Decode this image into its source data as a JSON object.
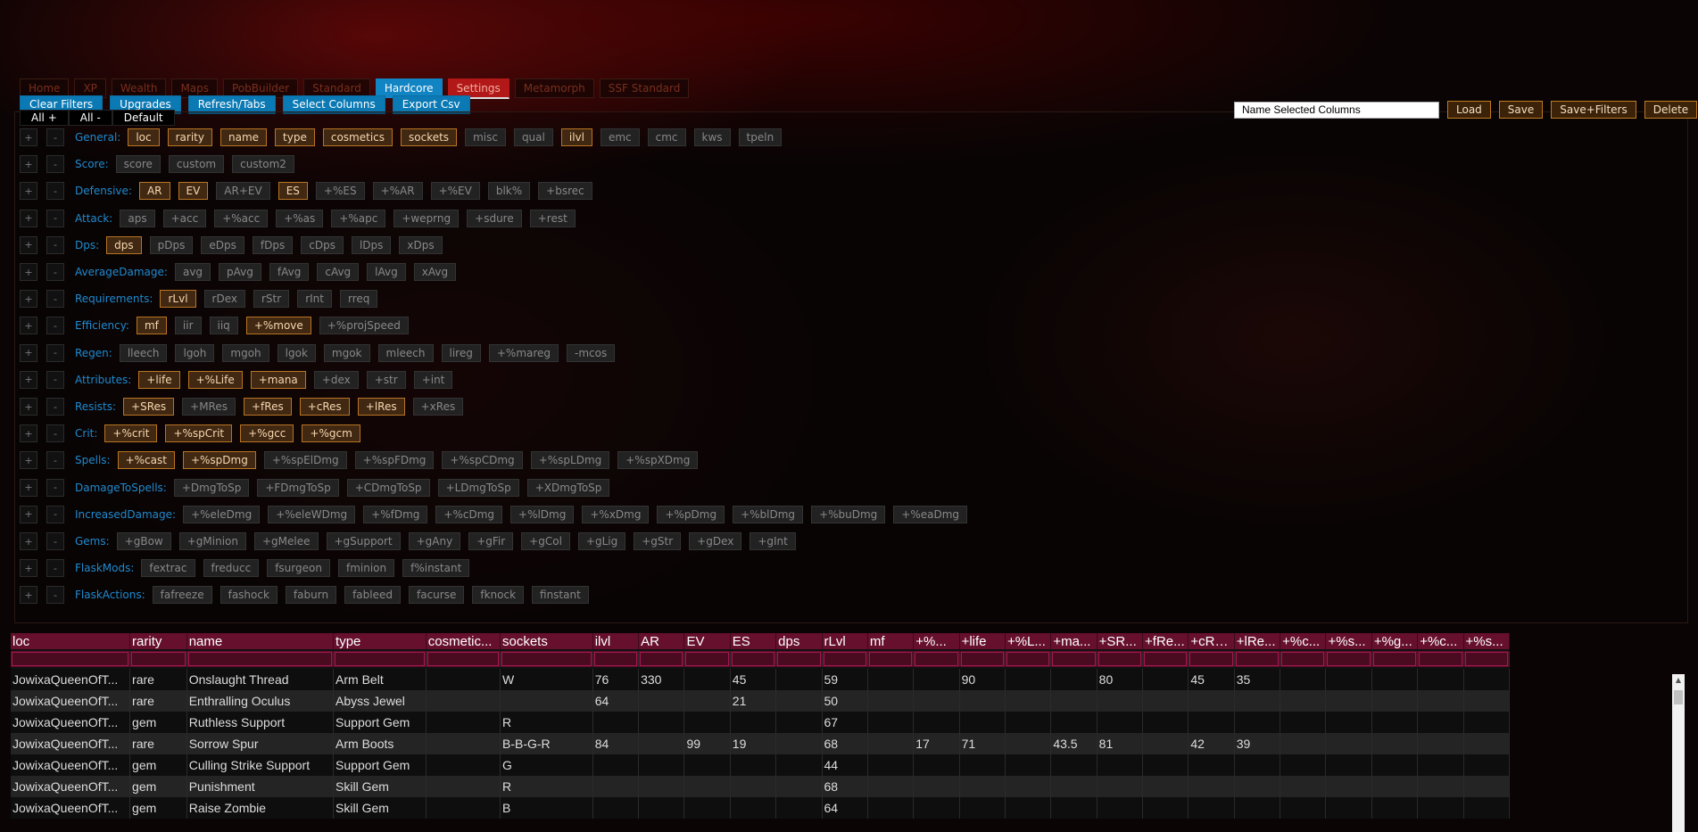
{
  "nav": {
    "tabs": [
      {
        "label": "Home",
        "state": "normal"
      },
      {
        "label": "XP",
        "state": "normal"
      },
      {
        "label": "Wealth",
        "state": "normal"
      },
      {
        "label": "Maps",
        "state": "normal"
      },
      {
        "label": "PobBuilder",
        "state": "normal"
      },
      {
        "label": "Standard",
        "state": "normal"
      },
      {
        "label": "Hardcore",
        "state": "active"
      },
      {
        "label": "Settings",
        "state": "settings"
      },
      {
        "label": "Metamorph",
        "state": "normal"
      },
      {
        "label": "SSF Standard",
        "state": "normal"
      }
    ]
  },
  "actions": {
    "buttons": [
      "Clear Filters",
      "Upgrades",
      "Refresh/Tabs",
      "Select Columns",
      "Export Csv"
    ],
    "all_plus": "All +",
    "all_minus": "All -",
    "default": "Default"
  },
  "presets": {
    "name_placeholder": "Name Selected Columns",
    "load": "Load",
    "save": "Save",
    "save_filters": "Save+Filters",
    "delete": "Delete"
  },
  "filter_groups": [
    {
      "label": "General:",
      "chips": [
        {
          "t": "loc",
          "on": true
        },
        {
          "t": "rarity",
          "on": true
        },
        {
          "t": "name",
          "on": true
        },
        {
          "t": "type",
          "on": true
        },
        {
          "t": "cosmetics",
          "on": true
        },
        {
          "t": "sockets",
          "on": true
        },
        {
          "t": "misc",
          "on": false
        },
        {
          "t": "qual",
          "on": false
        },
        {
          "t": "ilvl",
          "on": true
        },
        {
          "t": "emc",
          "on": false
        },
        {
          "t": "cmc",
          "on": false
        },
        {
          "t": "kws",
          "on": false
        },
        {
          "t": "tpeln",
          "on": false
        }
      ]
    },
    {
      "label": "Score:",
      "chips": [
        {
          "t": "score",
          "on": false
        },
        {
          "t": "custom",
          "on": false
        },
        {
          "t": "custom2",
          "on": false
        }
      ]
    },
    {
      "label": "Defensive:",
      "chips": [
        {
          "t": "AR",
          "on": true
        },
        {
          "t": "EV",
          "on": true
        },
        {
          "t": "AR+EV",
          "on": false
        },
        {
          "t": "ES",
          "on": true
        },
        {
          "t": "+%ES",
          "on": false
        },
        {
          "t": "+%AR",
          "on": false
        },
        {
          "t": "+%EV",
          "on": false
        },
        {
          "t": "blk%",
          "on": false
        },
        {
          "t": "+bsrec",
          "on": false
        }
      ]
    },
    {
      "label": "Attack:",
      "chips": [
        {
          "t": "aps",
          "on": false
        },
        {
          "t": "+acc",
          "on": false
        },
        {
          "t": "+%acc",
          "on": false
        },
        {
          "t": "+%as",
          "on": false
        },
        {
          "t": "+%apc",
          "on": false
        },
        {
          "t": "+weprng",
          "on": false
        },
        {
          "t": "+sdure",
          "on": false
        },
        {
          "t": "+rest",
          "on": false
        }
      ]
    },
    {
      "label": "Dps:",
      "chips": [
        {
          "t": "dps",
          "on": true
        },
        {
          "t": "pDps",
          "on": false
        },
        {
          "t": "eDps",
          "on": false
        },
        {
          "t": "fDps",
          "on": false
        },
        {
          "t": "cDps",
          "on": false
        },
        {
          "t": "lDps",
          "on": false
        },
        {
          "t": "xDps",
          "on": false
        }
      ]
    },
    {
      "label": "AverageDamage:",
      "chips": [
        {
          "t": "avg",
          "on": false
        },
        {
          "t": "pAvg",
          "on": false
        },
        {
          "t": "fAvg",
          "on": false
        },
        {
          "t": "cAvg",
          "on": false
        },
        {
          "t": "lAvg",
          "on": false
        },
        {
          "t": "xAvg",
          "on": false
        }
      ]
    },
    {
      "label": "Requirements:",
      "chips": [
        {
          "t": "rLvl",
          "on": true
        },
        {
          "t": "rDex",
          "on": false
        },
        {
          "t": "rStr",
          "on": false
        },
        {
          "t": "rInt",
          "on": false
        },
        {
          "t": "rreq",
          "on": false
        }
      ]
    },
    {
      "label": "Efficiency:",
      "chips": [
        {
          "t": "mf",
          "on": true
        },
        {
          "t": "iir",
          "on": false
        },
        {
          "t": "iiq",
          "on": false
        },
        {
          "t": "+%move",
          "on": true
        },
        {
          "t": "+%projSpeed",
          "on": false
        }
      ]
    },
    {
      "label": "Regen:",
      "chips": [
        {
          "t": "lleech",
          "on": false
        },
        {
          "t": "lgoh",
          "on": false
        },
        {
          "t": "mgoh",
          "on": false
        },
        {
          "t": "lgok",
          "on": false
        },
        {
          "t": "mgok",
          "on": false
        },
        {
          "t": "mleech",
          "on": false
        },
        {
          "t": "lireg",
          "on": false
        },
        {
          "t": "+%mareg",
          "on": false
        },
        {
          "t": "-mcos",
          "on": false
        }
      ]
    },
    {
      "label": "Attributes:",
      "chips": [
        {
          "t": "+life",
          "on": true
        },
        {
          "t": "+%Life",
          "on": true
        },
        {
          "t": "+mana",
          "on": true
        },
        {
          "t": "+dex",
          "on": false
        },
        {
          "t": "+str",
          "on": false
        },
        {
          "t": "+int",
          "on": false
        }
      ]
    },
    {
      "label": "Resists:",
      "chips": [
        {
          "t": "+SRes",
          "on": true
        },
        {
          "t": "+MRes",
          "on": false
        },
        {
          "t": "+fRes",
          "on": true
        },
        {
          "t": "+cRes",
          "on": true
        },
        {
          "t": "+lRes",
          "on": true
        },
        {
          "t": "+xRes",
          "on": false
        }
      ]
    },
    {
      "label": "Crit:",
      "chips": [
        {
          "t": "+%crit",
          "on": true
        },
        {
          "t": "+%spCrit",
          "on": true
        },
        {
          "t": "+%gcc",
          "on": true
        },
        {
          "t": "+%gcm",
          "on": true
        }
      ]
    },
    {
      "label": "Spells:",
      "chips": [
        {
          "t": "+%cast",
          "on": true
        },
        {
          "t": "+%spDmg",
          "on": true
        },
        {
          "t": "+%spElDmg",
          "on": false
        },
        {
          "t": "+%spFDmg",
          "on": false
        },
        {
          "t": "+%spCDmg",
          "on": false
        },
        {
          "t": "+%spLDmg",
          "on": false
        },
        {
          "t": "+%spXDmg",
          "on": false
        }
      ]
    },
    {
      "label": "DamageToSpells:",
      "chips": [
        {
          "t": "+DmgToSp",
          "on": false
        },
        {
          "t": "+FDmgToSp",
          "on": false
        },
        {
          "t": "+CDmgToSp",
          "on": false
        },
        {
          "t": "+LDmgToSp",
          "on": false
        },
        {
          "t": "+XDmgToSp",
          "on": false
        }
      ]
    },
    {
      "label": "IncreasedDamage:",
      "chips": [
        {
          "t": "+%eleDmg",
          "on": false
        },
        {
          "t": "+%eleWDmg",
          "on": false
        },
        {
          "t": "+%fDmg",
          "on": false
        },
        {
          "t": "+%cDmg",
          "on": false
        },
        {
          "t": "+%lDmg",
          "on": false
        },
        {
          "t": "+%xDmg",
          "on": false
        },
        {
          "t": "+%pDmg",
          "on": false
        },
        {
          "t": "+%blDmg",
          "on": false
        },
        {
          "t": "+%buDmg",
          "on": false
        },
        {
          "t": "+%eaDmg",
          "on": false
        }
      ]
    },
    {
      "label": "Gems:",
      "chips": [
        {
          "t": "+gBow",
          "on": false
        },
        {
          "t": "+gMinion",
          "on": false
        },
        {
          "t": "+gMelee",
          "on": false
        },
        {
          "t": "+gSupport",
          "on": false
        },
        {
          "t": "+gAny",
          "on": false
        },
        {
          "t": "+gFir",
          "on": false
        },
        {
          "t": "+gCol",
          "on": false
        },
        {
          "t": "+gLig",
          "on": false
        },
        {
          "t": "+gStr",
          "on": false
        },
        {
          "t": "+gDex",
          "on": false
        },
        {
          "t": "+gInt",
          "on": false
        }
      ]
    },
    {
      "label": "FlaskMods:",
      "chips": [
        {
          "t": "fextrac",
          "on": false
        },
        {
          "t": "freducc",
          "on": false
        },
        {
          "t": "fsurgeon",
          "on": false
        },
        {
          "t": "fminion",
          "on": false
        },
        {
          "t": "f%instant",
          "on": false
        }
      ]
    },
    {
      "label": "FlaskActions:",
      "chips": [
        {
          "t": "fafreeze",
          "on": false
        },
        {
          "t": "fashock",
          "on": false
        },
        {
          "t": "faburn",
          "on": false
        },
        {
          "t": "fableed",
          "on": false
        },
        {
          "t": "facurse",
          "on": false
        },
        {
          "t": "fknock",
          "on": false
        },
        {
          "t": "finstant",
          "on": false
        }
      ]
    }
  ],
  "pm_labels": {
    "plus": "+",
    "minus": "-"
  },
  "table": {
    "columns": [
      "loc",
      "rarity",
      "name",
      "type",
      "cosmetic...",
      "sockets",
      "ilvl",
      "AR",
      "EV",
      "ES",
      "dps",
      "rLvl",
      "mf",
      "+%...",
      "+life",
      "+%L...",
      "+ma...",
      "+SR...",
      "+fRe...",
      "+cRe...",
      "+lRe...",
      "+%c...",
      "+%s...",
      "+%g...",
      "+%c...",
      "+%s..."
    ],
    "rows": [
      [
        "JowixaQueenOfT...",
        "rare",
        "Onslaught Thread",
        "Arm Belt",
        "",
        "W",
        "76",
        "330",
        "",
        "45",
        "",
        "59",
        "",
        "",
        "90",
        "",
        "",
        "80",
        "",
        "45",
        "35",
        "",
        "",
        "",
        "",
        ""
      ],
      [
        "JowixaQueenOfT...",
        "rare",
        "Enthralling Oculus",
        "Abyss Jewel",
        "",
        "",
        "64",
        "",
        "",
        "21",
        "",
        "50",
        "",
        "",
        "",
        "",
        "",
        "",
        "",
        "",
        "",
        "",
        "",
        "",
        "",
        ""
      ],
      [
        "JowixaQueenOfT...",
        "gem",
        "Ruthless Support",
        "Support Gem",
        "",
        "R",
        "",
        "",
        "",
        "",
        "",
        "67",
        "",
        "",
        "",
        "",
        "",
        "",
        "",
        "",
        "",
        "",
        "",
        "",
        "",
        ""
      ],
      [
        "JowixaQueenOfT...",
        "rare",
        "Sorrow Spur",
        "Arm Boots",
        "",
        "B-B-G-R",
        "84",
        "",
        "99",
        "19",
        "",
        "68",
        "",
        "17",
        "71",
        "",
        "43.5",
        "81",
        "",
        "42",
        "39",
        "",
        "",
        "",
        "",
        ""
      ],
      [
        "JowixaQueenOfT...",
        "gem",
        "Culling Strike Support",
        "Support Gem",
        "",
        "G",
        "",
        "",
        "",
        "",
        "",
        "44",
        "",
        "",
        "",
        "",
        "",
        "",
        "",
        "",
        "",
        "",
        "",
        "",
        "",
        ""
      ],
      [
        "JowixaQueenOfT...",
        "gem",
        "Punishment",
        "Skill Gem",
        "",
        "R",
        "",
        "",
        "",
        "",
        "",
        "68",
        "",
        "",
        "",
        "",
        "",
        "",
        "",
        "",
        "",
        "",
        "",
        "",
        "",
        ""
      ],
      [
        "JowixaQueenOfT...",
        "gem",
        "Raise Zombie",
        "Skill Gem",
        "",
        "B",
        "",
        "",
        "",
        "",
        "",
        "64",
        "",
        "",
        "",
        "",
        "",
        "",
        "",
        "",
        "",
        "",
        "",
        "",
        "",
        ""
      ]
    ]
  },
  "scrollbar": {
    "up_arrow": "▲"
  }
}
